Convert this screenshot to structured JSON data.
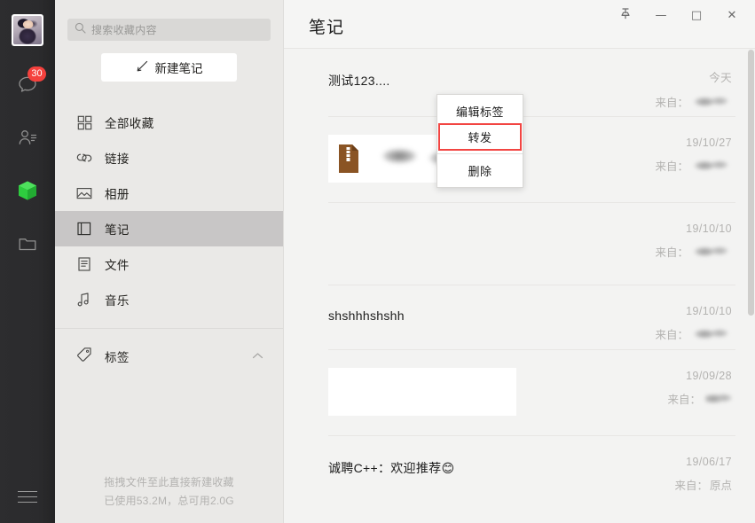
{
  "window": {
    "controls": [
      {
        "name": "pin-on-top",
        "glyph": "··",
        "label": "置顶"
      },
      {
        "name": "minimize",
        "glyph": "—",
        "label": "最小化"
      },
      {
        "name": "maximize",
        "glyph": "□",
        "label": "最大化"
      },
      {
        "name": "close",
        "glyph": "✕",
        "label": "关闭"
      }
    ]
  },
  "rail": {
    "avatar_alt": "用户头像",
    "items": [
      {
        "icon": "chat-icon",
        "badge": "30",
        "label": "微信"
      },
      {
        "icon": "contacts-icon",
        "badge": "",
        "label": "通讯录"
      },
      {
        "icon": "favorites-cube-icon",
        "badge": "",
        "label": "收藏"
      },
      {
        "icon": "files-folder-icon",
        "badge": "",
        "label": "文件"
      }
    ],
    "menu_label": "更多"
  },
  "sidebar": {
    "search": {
      "placeholder": "搜索收藏内容",
      "value": ""
    },
    "new_note_label": "新建笔记",
    "items": [
      {
        "icon": "grid-icon",
        "label": "全部收藏",
        "active": false
      },
      {
        "icon": "link-icon",
        "label": "链接",
        "active": false
      },
      {
        "icon": "photo-icon",
        "label": "相册",
        "active": false
      },
      {
        "icon": "note-icon",
        "label": "笔记",
        "active": true
      },
      {
        "icon": "file-icon",
        "label": "文件",
        "active": false
      },
      {
        "icon": "music-icon",
        "label": "音乐",
        "active": false
      }
    ],
    "tags_label": "标签",
    "footer_line1": "拖拽文件至此直接新建收藏",
    "footer_line2": "已使用53.2M，总可用2.0G"
  },
  "main": {
    "title": "笔记",
    "from_label": "来自：",
    "rows": [
      {
        "kind": "text",
        "text": "测试123....",
        "date": "今天",
        "from": ""
      },
      {
        "kind": "file",
        "text": "",
        "date": "19/10/27",
        "from": ""
      },
      {
        "kind": "empty",
        "text": "",
        "date": "19/10/10",
        "from": ""
      },
      {
        "kind": "text",
        "text": "shshhhshshh",
        "date": "19/10/10",
        "from": ""
      },
      {
        "kind": "image",
        "text": "",
        "date": "19/09/28",
        "from": ""
      },
      {
        "kind": "text",
        "text": "诚聘C++：欢迎推荐😊",
        "date": "19/06/17",
        "from": "原点"
      }
    ]
  },
  "context_menu": {
    "items": [
      {
        "label": "编辑标签",
        "highlighted": false
      },
      {
        "label": "转发",
        "highlighted": true
      },
      {
        "label": "删除",
        "highlighted": false
      }
    ],
    "highlight_color": "#f24542"
  },
  "colors": {
    "rail_bg": "#2b2b2d",
    "sidebar_bg": "#eae9e7",
    "active_item_bg": "#c8c6c6",
    "main_bg": "#f3f3f2",
    "badge_red": "#f5413d",
    "cube_green": "#2ecc3f",
    "highlight_red": "#f24542"
  }
}
